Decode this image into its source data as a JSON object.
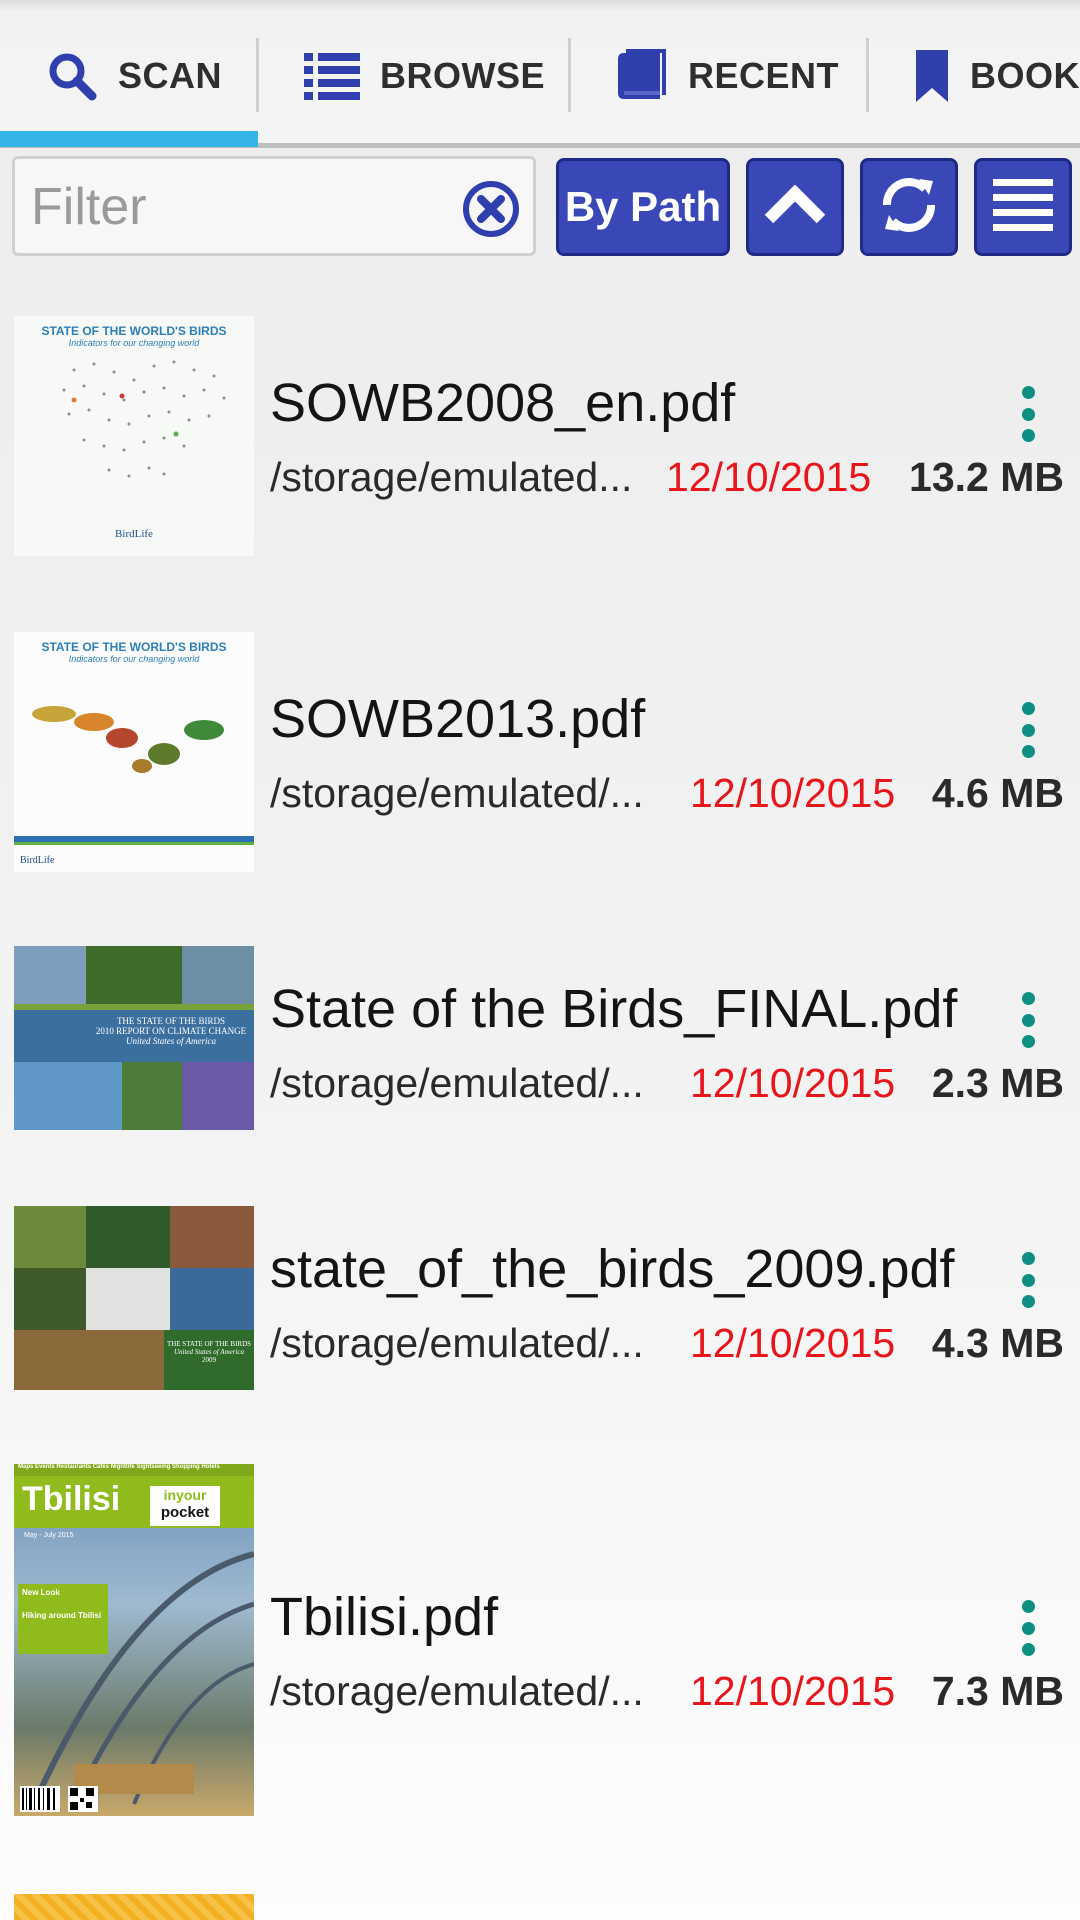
{
  "tabs": [
    {
      "label": "SCAN",
      "icon": "search-icon"
    },
    {
      "label": "BROWSE",
      "icon": "list-icon"
    },
    {
      "label": "RECENT",
      "icon": "book-icon"
    },
    {
      "label": "BOOKM",
      "icon": "bookmark-icon"
    }
  ],
  "toolbar": {
    "filter_placeholder": "Filter",
    "sort_label": "By Path"
  },
  "files": [
    {
      "name": "SOWB2008_en.pdf",
      "path": "/storage/emulated...",
      "date": "12/10/2015",
      "size": "13.2 MB",
      "cover": {
        "title": "STATE OF THE WORLD'S BIRDS",
        "subtitle": "Indicators for our changing world",
        "logo": "BirdLife"
      }
    },
    {
      "name": "SOWB2013.pdf",
      "path": "/storage/emulated/...",
      "date": "12/10/2015",
      "size": "4.6 MB",
      "cover": {
        "title": "STATE OF THE WORLD'S BIRDS",
        "subtitle": "Indicators for our changing world",
        "logo": "BirdLife"
      }
    },
    {
      "name": "State of the Birds_FINAL.pdf",
      "path": "/storage/emulated/...",
      "date": "12/10/2015",
      "size": "2.3 MB",
      "cover": {
        "title": "THE STATE OF THE BIRDS",
        "subtitle": "2010 REPORT ON CLIMATE CHANGE",
        "tagline": "United States of America"
      }
    },
    {
      "name": "state_of_the_birds_2009.pdf",
      "path": "/storage/emulated/...",
      "date": "12/10/2015",
      "size": "4.3 MB",
      "cover": {
        "title": "THE STATE OF THE BIRDS",
        "subtitle": "United States of America",
        "tagline": "2009"
      }
    },
    {
      "name": "Tbilisi.pdf",
      "path": "/storage/emulated/...",
      "date": "12/10/2015",
      "size": "7.3 MB",
      "cover": {
        "title": "Tbilisi",
        "badge_top": "inyour",
        "badge_bottom": "pocket",
        "header": "Maps Events Restaurants Cafés Nightlife Sightseeing Shopping Hotels",
        "edition": "May - July 2015",
        "blurb1": "New Look",
        "blurb2": "Hiking around Tbilisi"
      }
    }
  ],
  "colors": {
    "accent": "#33b5e5",
    "button": "#3a48b7",
    "date": "#e8151b",
    "more": "#0f8f82"
  }
}
